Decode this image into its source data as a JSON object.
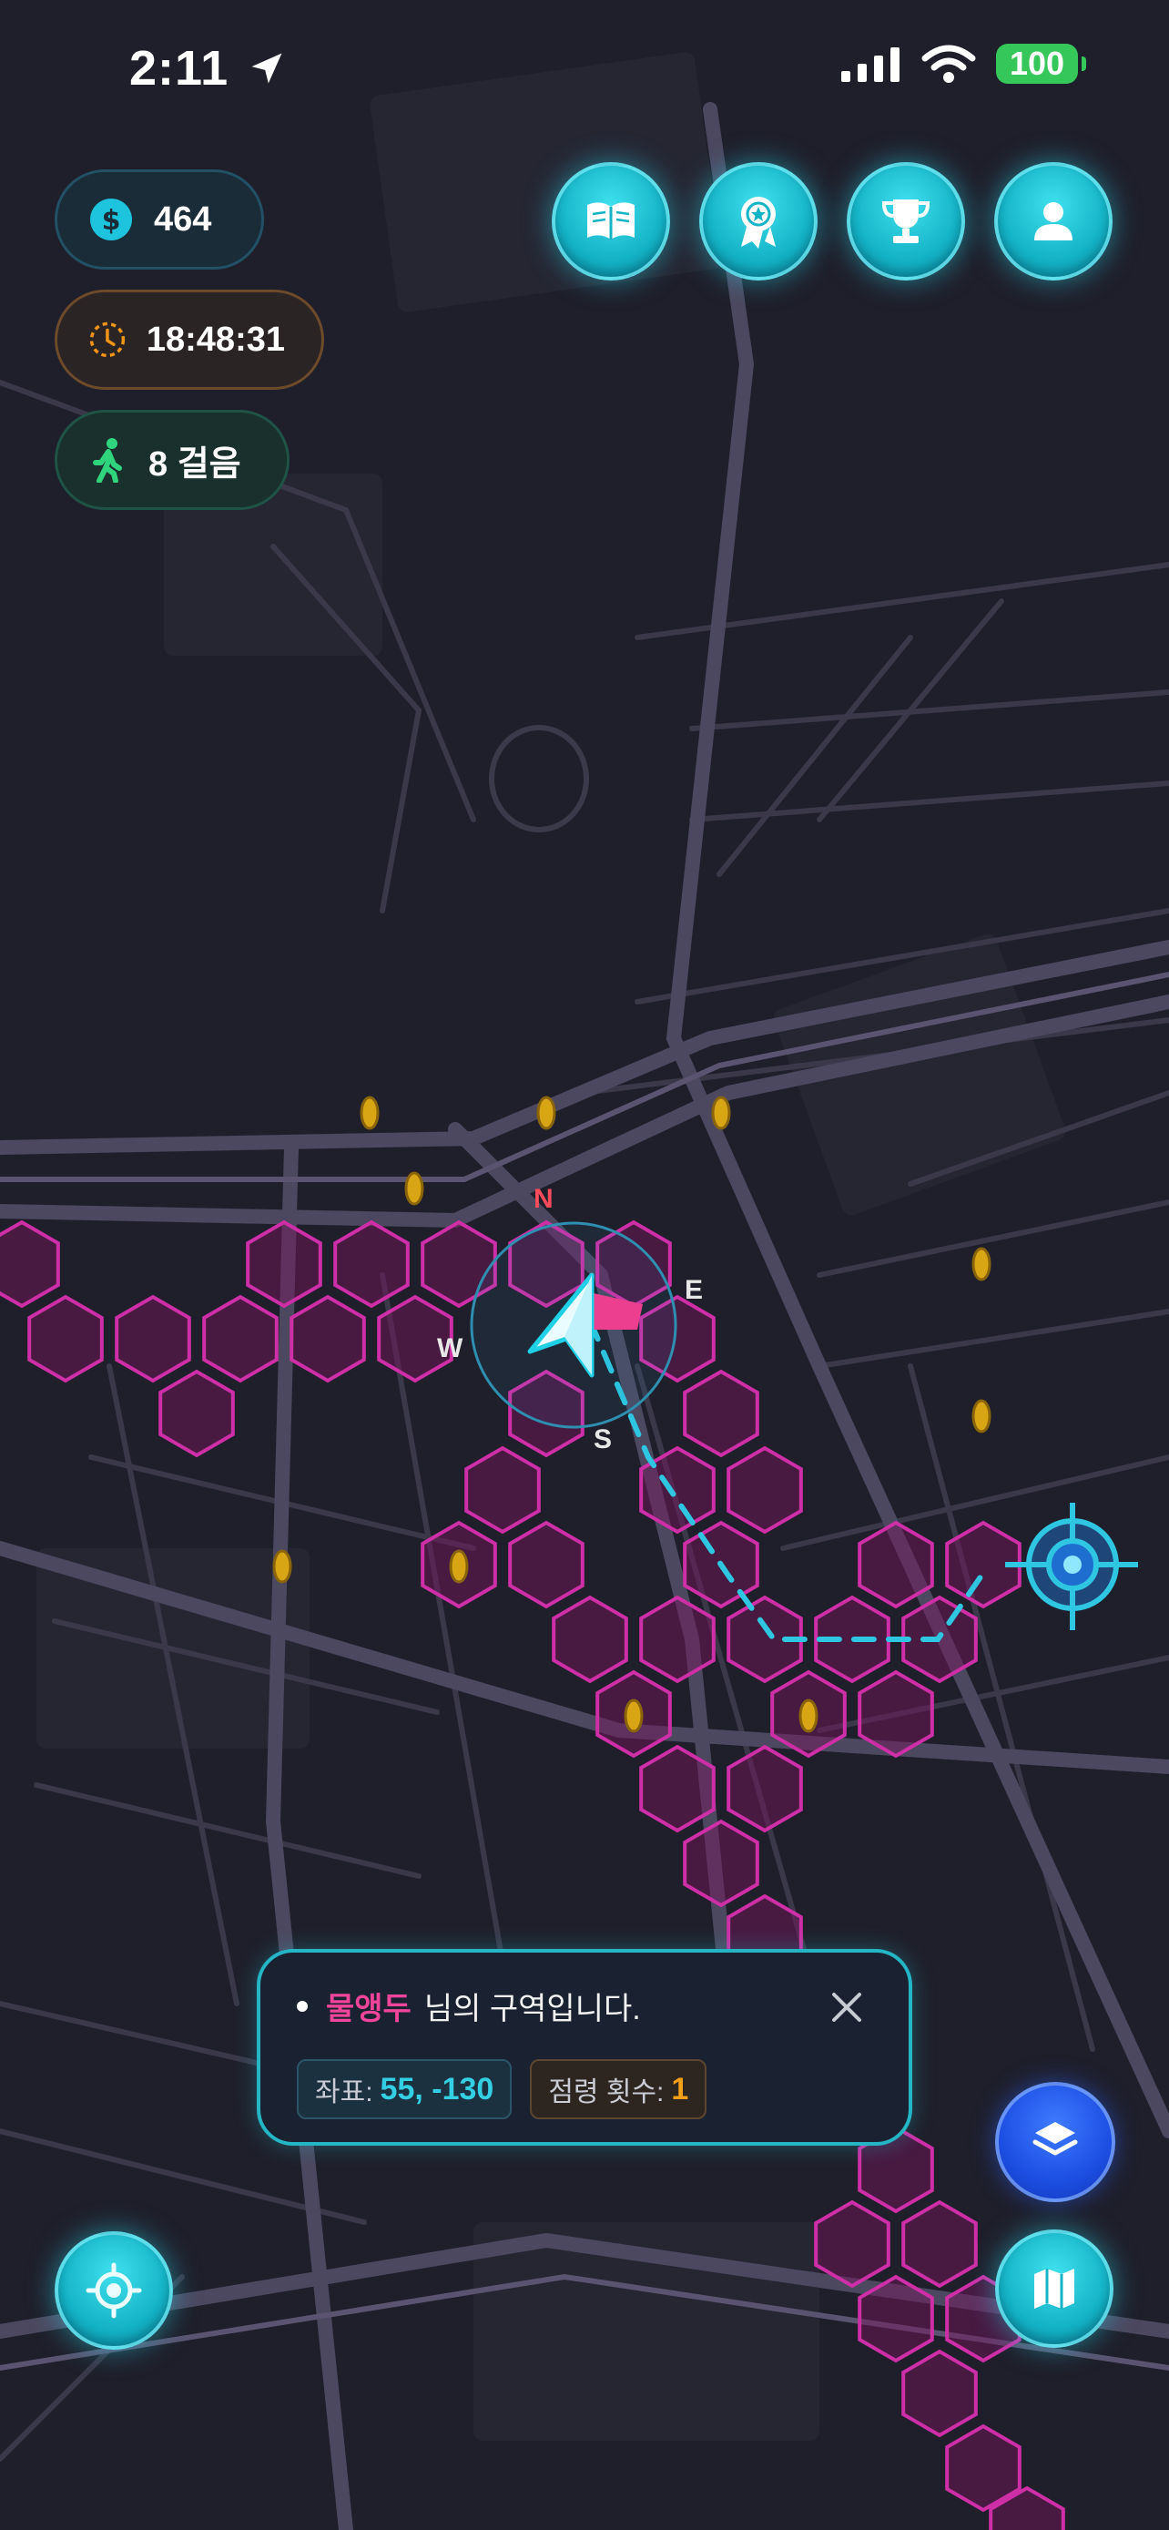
{
  "status_bar": {
    "time": "2:11",
    "battery": "100"
  },
  "stats": {
    "coins": "464",
    "timer": "18:48:31",
    "steps": "8 걸음"
  },
  "top_buttons": [
    {
      "icon": "book-icon"
    },
    {
      "icon": "badge-icon"
    },
    {
      "icon": "trophy-icon"
    },
    {
      "icon": "profile-icon"
    }
  ],
  "compass": {
    "north": "N",
    "east": "E",
    "south": "S",
    "west": "W"
  },
  "popup": {
    "owner_name": "물앵두",
    "owner_suffix": "님의 구역입니다.",
    "coord_label": "좌표:",
    "coord_value": "55, -130",
    "capture_label": "점령 횟수:",
    "capture_value": "1"
  },
  "colors": {
    "background": "#1f1f2b",
    "territory": "#c8209a",
    "accent": "#25b6c6",
    "coin": "#d8a515",
    "path": "#2ec6e0",
    "owner": "#f0459a"
  },
  "bottom_buttons": {
    "locate": "crosshair-icon",
    "layers": "layers-icon",
    "map": "map-icon"
  }
}
